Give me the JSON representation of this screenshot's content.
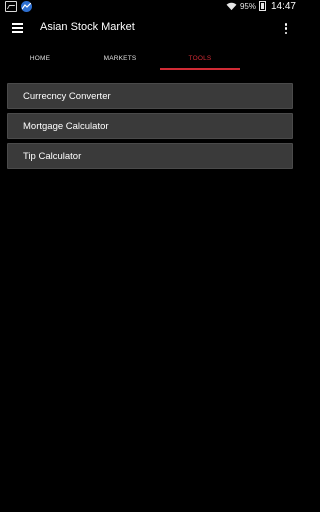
{
  "status_bar": {
    "battery_percent": "95%",
    "time": "14:47",
    "icons": [
      "image-notification-icon",
      "stock-app-icon",
      "wifi-icon",
      "battery-icon"
    ]
  },
  "app_bar": {
    "title": "Asian Stock Market",
    "icons": [
      "menu-icon",
      "overflow-menu-icon"
    ]
  },
  "tabs": [
    {
      "label": "HOME",
      "active": false
    },
    {
      "label": "MARKETS",
      "active": false
    },
    {
      "label": "TOOLS",
      "active": true
    }
  ],
  "tools": [
    {
      "label": "Currecncy Converter"
    },
    {
      "label": "Mortgage Calculator"
    },
    {
      "label": "Tip Calculator"
    }
  ],
  "colors": {
    "background": "#000000",
    "accent": "#d12b35",
    "list_item_bg": "#3a3a3a"
  }
}
